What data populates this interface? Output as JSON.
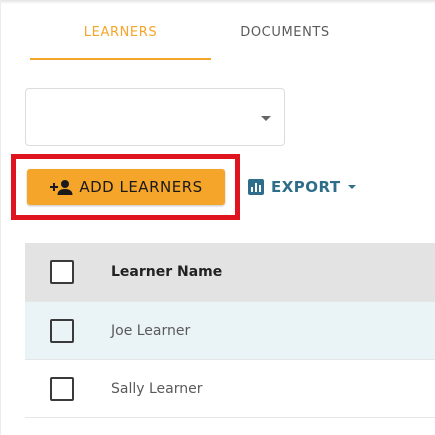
{
  "tabs": [
    {
      "label": "LEARNERS",
      "active": true
    },
    {
      "label": "DOCUMENTS",
      "active": false
    }
  ],
  "select": {
    "value": ""
  },
  "actions": {
    "add_learners_label": "ADD LEARNERS",
    "export_label": "EXPORT"
  },
  "table": {
    "header": "Learner Name",
    "rows": [
      {
        "name": "Joe Learner"
      },
      {
        "name": "Sally Learner"
      }
    ]
  },
  "colors": {
    "accent": "#f5a52a",
    "export": "#2f6e8a",
    "highlight": "#e0141e",
    "row_alt": "#eaf3f6",
    "header_bg": "#e3e3e3"
  },
  "icons": {
    "add_learners": "person-add-icon",
    "export": "chart-icon",
    "select": "caret-down-icon"
  }
}
